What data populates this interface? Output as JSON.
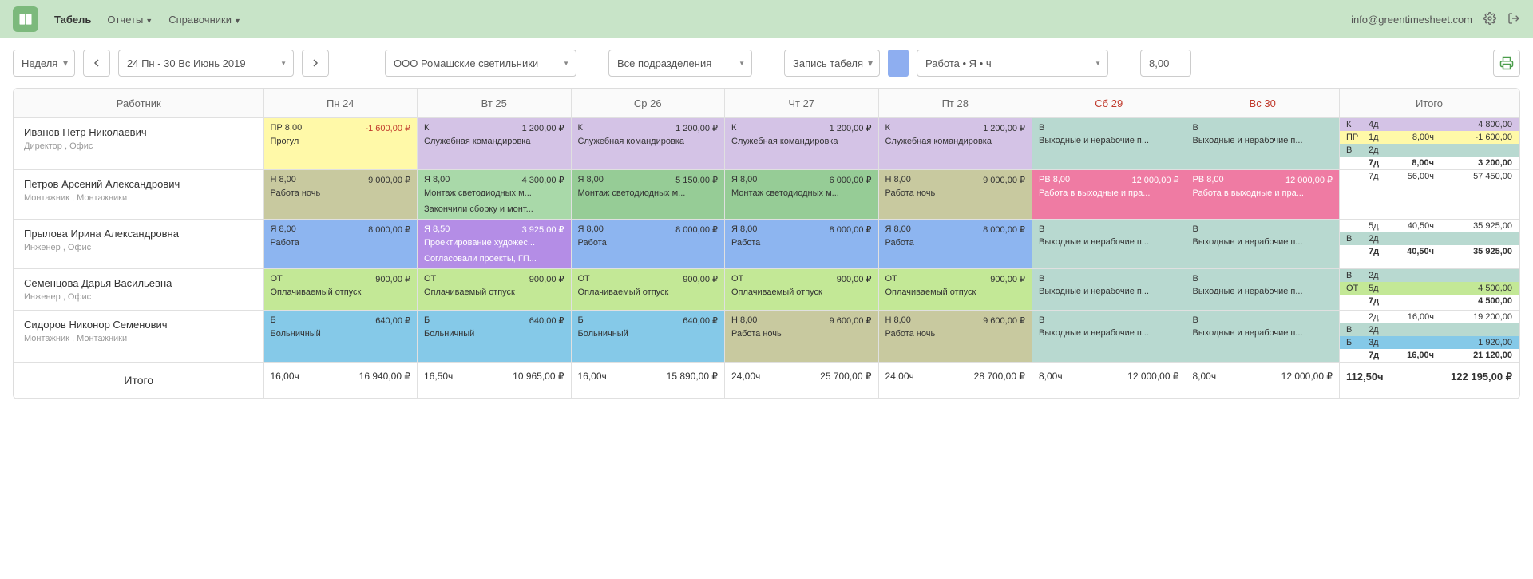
{
  "header": {
    "nav": {
      "tabel": "Табель",
      "reports": "Отчеты",
      "refs": "Справочники"
    },
    "email": "info@greentimesheet.com"
  },
  "toolbar": {
    "period": "Неделя",
    "date_range": "24 Пн - 30 Вс Июнь 2019",
    "company": "ООО Ромашские светильники",
    "department": "Все подразделения",
    "mode": "Запись табеля",
    "worktype": "Работа • Я • ч",
    "hours": "8,00"
  },
  "columns": {
    "employee": "Работник",
    "days": [
      "Пн 24",
      "Вт 25",
      "Ср 26",
      "Чт 27",
      "Пт 28",
      "Сб 29",
      "Вс 30"
    ],
    "total": "Итого"
  },
  "rows": [
    {
      "name": "Иванов Петр Николаевич",
      "role": "Директор , Офис",
      "cells": [
        {
          "cls": "c-yellow",
          "code": "ПР 8,00",
          "amt": "-1 600,00 ₽",
          "neg": true,
          "desc": "Прогул"
        },
        {
          "cls": "c-purple",
          "code": "К",
          "amt": "1 200,00 ₽",
          "desc": "Служебная командировка"
        },
        {
          "cls": "c-purple",
          "code": "К",
          "amt": "1 200,00 ₽",
          "desc": "Служебная командировка"
        },
        {
          "cls": "c-purple",
          "code": "К",
          "amt": "1 200,00 ₽",
          "desc": "Служебная командировка"
        },
        {
          "cls": "c-purple",
          "code": "К",
          "amt": "1 200,00 ₽",
          "desc": "Служебная командировка"
        },
        {
          "cls": "c-teal",
          "code": "В",
          "amt": "",
          "desc": "Выходные и нерабочие п..."
        },
        {
          "cls": "c-teal",
          "code": "В",
          "amt": "",
          "desc": "Выходные и нерабочие п..."
        }
      ],
      "totals": [
        {
          "cls": "t-purple",
          "code": "К",
          "days": "4д",
          "hours": "",
          "amt": "4 800,00"
        },
        {
          "cls": "t-yellow",
          "code": "ПР",
          "days": "1д",
          "hours": "8,00ч",
          "amt": "-1 600,00"
        },
        {
          "cls": "t-teal",
          "code": "В",
          "days": "2д",
          "hours": "",
          "amt": ""
        },
        {
          "cls": "",
          "bold": true,
          "code": "",
          "days": "7д",
          "hours": "8,00ч",
          "amt": "3 200,00"
        }
      ]
    },
    {
      "name": "Петров Арсений Александрович",
      "role": "Монтажник , Монтажники",
      "cells": [
        {
          "cls": "c-olive",
          "code": "Н 8,00",
          "amt": "9 000,00 ₽",
          "desc": "Работа ночь"
        },
        {
          "cls": "c-green",
          "code": "Я 8,00",
          "amt": "4 300,00 ₽",
          "desc": "Монтаж светодиодных м...",
          "extra": "Закончили сборку и монт..."
        },
        {
          "cls": "c-green2",
          "code": "Я 8,00",
          "amt": "5 150,00 ₽",
          "desc": "Монтаж светодиодных м..."
        },
        {
          "cls": "c-green2",
          "code": "Я 8,00",
          "amt": "6 000,00 ₽",
          "desc": "Монтаж светодиодных м..."
        },
        {
          "cls": "c-olive",
          "code": "Н 8,00",
          "amt": "9 000,00 ₽",
          "desc": "Работа ночь"
        },
        {
          "cls": "c-pink",
          "code": "РВ 8,00",
          "amt": "12 000,00 ₽",
          "desc": "Работа в выходные и пра..."
        },
        {
          "cls": "c-pink",
          "code": "РВ 8,00",
          "amt": "12 000,00 ₽",
          "desc": "Работа в выходные и пра..."
        }
      ],
      "totals": [
        {
          "cls": "",
          "code": "",
          "days": "7д",
          "hours": "56,00ч",
          "amt": "57 450,00"
        }
      ]
    },
    {
      "name": "Прылова Ирина Александровна",
      "role": "Инженер , Офис",
      "cells": [
        {
          "cls": "c-blue",
          "code": "Я 8,00",
          "amt": "8 000,00 ₽",
          "desc": "Работа"
        },
        {
          "cls": "c-violet",
          "code": "Я 8,50",
          "amt": "3 925,00 ₽",
          "desc": "Проектирование художес...",
          "extra": "Согласовали проекты, ГП..."
        },
        {
          "cls": "c-blue",
          "code": "Я 8,00",
          "amt": "8 000,00 ₽",
          "desc": "Работа"
        },
        {
          "cls": "c-blue",
          "code": "Я 8,00",
          "amt": "8 000,00 ₽",
          "desc": "Работа"
        },
        {
          "cls": "c-blue",
          "code": "Я 8,00",
          "amt": "8 000,00 ₽",
          "desc": "Работа"
        },
        {
          "cls": "c-teal",
          "code": "В",
          "amt": "",
          "desc": "Выходные и нерабочие п..."
        },
        {
          "cls": "c-teal",
          "code": "В",
          "amt": "",
          "desc": "Выходные и нерабочие п..."
        }
      ],
      "totals": [
        {
          "cls": "",
          "code": "",
          "days": "5д",
          "hours": "40,50ч",
          "amt": "35 925,00"
        },
        {
          "cls": "t-teal",
          "code": "В",
          "days": "2д",
          "hours": "",
          "amt": ""
        },
        {
          "cls": "",
          "bold": true,
          "code": "",
          "days": "7д",
          "hours": "40,50ч",
          "amt": "35 925,00"
        }
      ]
    },
    {
      "name": "Семенцова Дарья Васильевна",
      "role": "Инженер , Офис",
      "cells": [
        {
          "cls": "c-lime",
          "code": "ОТ",
          "amt": "900,00 ₽",
          "desc": "Оплачиваемый отпуск"
        },
        {
          "cls": "c-lime",
          "code": "ОТ",
          "amt": "900,00 ₽",
          "desc": "Оплачиваемый отпуск"
        },
        {
          "cls": "c-lime",
          "code": "ОТ",
          "amt": "900,00 ₽",
          "desc": "Оплачиваемый отпуск"
        },
        {
          "cls": "c-lime",
          "code": "ОТ",
          "amt": "900,00 ₽",
          "desc": "Оплачиваемый отпуск"
        },
        {
          "cls": "c-lime",
          "code": "ОТ",
          "amt": "900,00 ₽",
          "desc": "Оплачиваемый отпуск"
        },
        {
          "cls": "c-teal",
          "code": "В",
          "amt": "",
          "desc": "Выходные и нерабочие п..."
        },
        {
          "cls": "c-teal",
          "code": "В",
          "amt": "",
          "desc": "Выходные и нерабочие п..."
        }
      ],
      "totals": [
        {
          "cls": "t-teal",
          "code": "В",
          "days": "2д",
          "hours": "",
          "amt": ""
        },
        {
          "cls": "t-lime",
          "code": "ОТ",
          "days": "5д",
          "hours": "",
          "amt": "4 500,00"
        },
        {
          "cls": "",
          "bold": true,
          "code": "",
          "days": "7д",
          "hours": "",
          "amt": "4 500,00"
        }
      ]
    },
    {
      "name": "Сидоров Никонор Семенович",
      "role": "Монтажник , Монтажники",
      "cells": [
        {
          "cls": "c-sky",
          "code": "Б",
          "amt": "640,00 ₽",
          "desc": "Больничный"
        },
        {
          "cls": "c-sky",
          "code": "Б",
          "amt": "640,00 ₽",
          "desc": "Больничный"
        },
        {
          "cls": "c-sky",
          "code": "Б",
          "amt": "640,00 ₽",
          "desc": "Больничный"
        },
        {
          "cls": "c-olive",
          "code": "Н 8,00",
          "amt": "9 600,00 ₽",
          "desc": "Работа ночь"
        },
        {
          "cls": "c-olive",
          "code": "Н 8,00",
          "amt": "9 600,00 ₽",
          "desc": "Работа ночь"
        },
        {
          "cls": "c-teal",
          "code": "В",
          "amt": "",
          "desc": "Выходные и нерабочие п..."
        },
        {
          "cls": "c-teal",
          "code": "В",
          "amt": "",
          "desc": "Выходные и нерабочие п..."
        }
      ],
      "totals": [
        {
          "cls": "",
          "code": "",
          "days": "2д",
          "hours": "16,00ч",
          "amt": "19 200,00"
        },
        {
          "cls": "t-teal",
          "code": "В",
          "days": "2д",
          "hours": "",
          "amt": ""
        },
        {
          "cls": "t-sky",
          "code": "Б",
          "days": "3д",
          "hours": "",
          "amt": "1 920,00"
        },
        {
          "cls": "",
          "bold": true,
          "code": "",
          "days": "7д",
          "hours": "16,00ч",
          "amt": "21 120,00"
        }
      ]
    }
  ],
  "footer": {
    "label": "Итого",
    "days": [
      {
        "h": "16,00ч",
        "a": "16 940,00 ₽"
      },
      {
        "h": "16,50ч",
        "a": "10 965,00 ₽"
      },
      {
        "h": "16,00ч",
        "a": "15 890,00 ₽"
      },
      {
        "h": "24,00ч",
        "a": "25 700,00 ₽"
      },
      {
        "h": "24,00ч",
        "a": "28 700,00 ₽"
      },
      {
        "h": "8,00ч",
        "a": "12 000,00 ₽"
      },
      {
        "h": "8,00ч",
        "a": "12 000,00 ₽"
      }
    ],
    "total": {
      "h": "112,50ч",
      "a": "122 195,00 ₽"
    }
  }
}
